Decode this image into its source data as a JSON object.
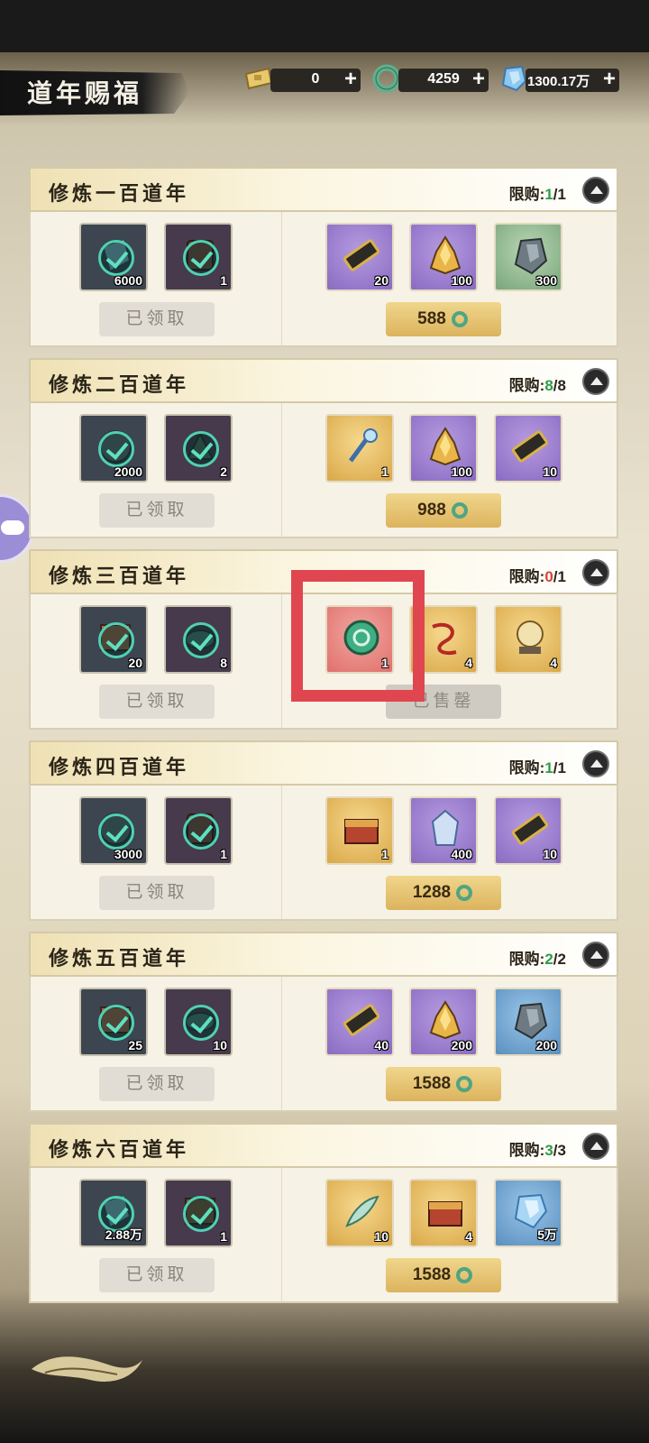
{
  "header": {
    "title": "道年赐福",
    "currencies": [
      {
        "icon": "ticket-icon",
        "value": "0"
      },
      {
        "icon": "jade-ring-icon",
        "value": "4259"
      },
      {
        "icon": "spirit-stone-icon",
        "value": "1300.17万"
      }
    ]
  },
  "cards": [
    {
      "title": "修炼一百道年",
      "limit_label": "限购:",
      "limit_used": "1",
      "limit_sep": "/",
      "limit_total": "1",
      "limit_color": "green",
      "free_items": [
        {
          "icon": "crystal-shard-icon",
          "qty": "6000"
        },
        {
          "icon": "token-icon",
          "qty": "1"
        }
      ],
      "free_button": "已领取",
      "paid_items": [
        {
          "icon": "gold-pass-icon",
          "qty": "20",
          "bg": "purple"
        },
        {
          "icon": "golden-ore-icon",
          "qty": "100",
          "bg": "purple"
        },
        {
          "icon": "iron-ore-icon",
          "qty": "300",
          "bg": "green"
        }
      ],
      "price": "588"
    },
    {
      "title": "修炼二百道年",
      "limit_label": "限购:",
      "limit_used": "8",
      "limit_sep": "/",
      "limit_total": "8",
      "limit_color": "green",
      "free_items": [
        {
          "icon": "rock-icon",
          "qty": "2000"
        },
        {
          "icon": "herb-icon",
          "qty": "2"
        }
      ],
      "free_button": "已领取",
      "paid_items": [
        {
          "icon": "jade-staff-icon",
          "qty": "1",
          "bg": "gold"
        },
        {
          "icon": "golden-ore-icon",
          "qty": "100",
          "bg": "purple"
        },
        {
          "icon": "gold-pass-icon",
          "qty": "10",
          "bg": "purple"
        }
      ],
      "price": "988"
    },
    {
      "title": "修炼三百道年",
      "limit_label": "限购:",
      "limit_used": "0",
      "limit_sep": "/",
      "limit_total": "1",
      "limit_color": "red",
      "free_items": [
        {
          "icon": "scroll-icon",
          "qty": "20"
        },
        {
          "icon": "pill-icon",
          "qty": "8"
        }
      ],
      "free_button": "已领取",
      "paid_items": [
        {
          "icon": "jade-coin-icon",
          "qty": "1",
          "bg": "red"
        },
        {
          "icon": "red-cord-icon",
          "qty": "4",
          "bg": "gold"
        },
        {
          "icon": "crystal-orb-icon",
          "qty": "4",
          "bg": "gold"
        }
      ],
      "sold_out": "已售罄"
    },
    {
      "title": "修炼四百道年",
      "limit_label": "限购:",
      "limit_used": "1",
      "limit_sep": "/",
      "limit_total": "1",
      "limit_color": "green",
      "free_items": [
        {
          "icon": "rock-icon",
          "qty": "3000"
        },
        {
          "icon": "token-icon",
          "qty": "1"
        }
      ],
      "free_button": "已领取",
      "paid_items": [
        {
          "icon": "treasure-chest-icon",
          "qty": "1",
          "bg": "gold"
        },
        {
          "icon": "ice-crystal-icon",
          "qty": "400",
          "bg": "purple"
        },
        {
          "icon": "gold-pass-icon",
          "qty": "10",
          "bg": "purple"
        }
      ],
      "price": "1288"
    },
    {
      "title": "修炼五百道年",
      "limit_label": "限购:",
      "limit_used": "2",
      "limit_sep": "/",
      "limit_total": "2",
      "limit_color": "green",
      "free_items": [
        {
          "icon": "scroll-icon",
          "qty": "25"
        },
        {
          "icon": "pill-icon",
          "qty": "10"
        }
      ],
      "free_button": "已领取",
      "paid_items": [
        {
          "icon": "gold-pass-icon",
          "qty": "40",
          "bg": "purple"
        },
        {
          "icon": "golden-ore-icon",
          "qty": "200",
          "bg": "purple"
        },
        {
          "icon": "iron-ore-icon",
          "qty": "200",
          "bg": "blue"
        }
      ],
      "price": "1588"
    },
    {
      "title": "修炼六百道年",
      "limit_label": "限购:",
      "limit_used": "3",
      "limit_sep": "/",
      "limit_total": "3",
      "limit_color": "green",
      "free_items": [
        {
          "icon": "crystal-shard-icon",
          "qty": "2.88万"
        },
        {
          "icon": "book-icon",
          "qty": "1"
        }
      ],
      "free_button": "已领取",
      "paid_items": [
        {
          "icon": "jade-feather-icon",
          "qty": "10",
          "bg": "gold"
        },
        {
          "icon": "treasure-chest-icon",
          "qty": "4",
          "bg": "gold"
        },
        {
          "icon": "spirit-stone-icon",
          "qty": "5万",
          "bg": "blue"
        }
      ],
      "price": "1588"
    }
  ]
}
